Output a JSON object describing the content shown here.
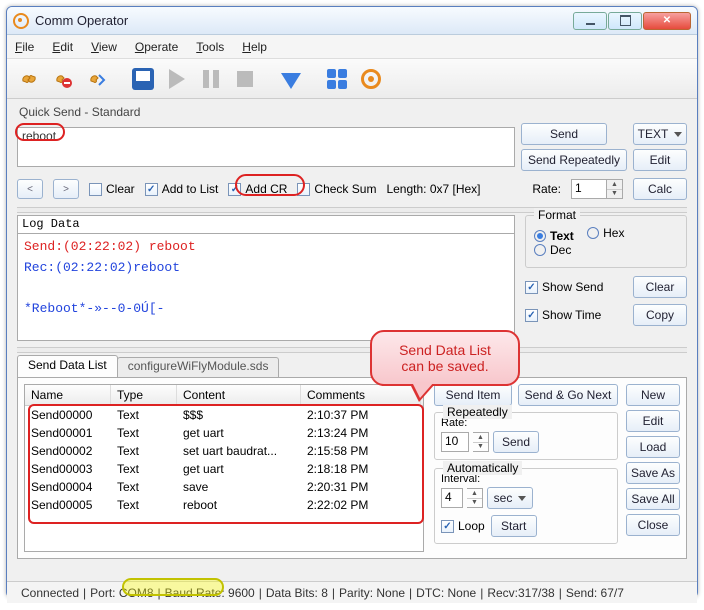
{
  "window": {
    "title": "Comm Operator"
  },
  "menu": {
    "file": "File",
    "edit": "Edit",
    "view": "View",
    "operate": "Operate",
    "tools": "Tools",
    "help": "Help"
  },
  "quicksend": {
    "section_label": "Quick Send - Standard",
    "input_value": "reboot",
    "send": "Send",
    "text_btn": "TEXT",
    "send_repeat": "Send Repeatedly",
    "edit": "Edit",
    "nav_prev": "<",
    "nav_next": ">",
    "clear": "Clear",
    "add_to_list": "Add to List",
    "add_cr": "Add CR",
    "check_sum": "Check Sum",
    "length_label": "Length: 0x7 [Hex]",
    "rate_label": "Rate:",
    "rate_value": "1",
    "calc": "Calc"
  },
  "log": {
    "header": "Log Data",
    "line1": "Send:(02:22:02) reboot",
    "line2": "Rec:(02:22:02)reboot",
    "line3": "*Reboot*-»--0-0Ú[-"
  },
  "format": {
    "legend": "Format",
    "text": "Text",
    "hex": "Hex",
    "dec": "Dec",
    "show_send": "Show Send",
    "show_time": "Show Time",
    "clear": "Clear",
    "copy": "Copy"
  },
  "sendlist": {
    "tab1": "Send Data List",
    "tab2": "configureWiFlyModule.sds",
    "cols": {
      "name": "Name",
      "type": "Type",
      "content": "Content",
      "comments": "Comments"
    },
    "rows": [
      {
        "name": "Send00000",
        "type": "Text",
        "content": "$$$",
        "comments": "2:10:37 PM"
      },
      {
        "name": "Send00001",
        "type": "Text",
        "content": "get uart",
        "comments": "2:13:24 PM"
      },
      {
        "name": "Send00002",
        "type": "Text",
        "content": "set uart baudrat...",
        "comments": "2:15:58 PM"
      },
      {
        "name": "Send00003",
        "type": "Text",
        "content": "get uart",
        "comments": "2:18:18 PM"
      },
      {
        "name": "Send00004",
        "type": "Text",
        "content": "save",
        "comments": "2:20:31 PM"
      },
      {
        "name": "Send00005",
        "type": "Text",
        "content": "reboot",
        "comments": "2:22:02 PM"
      }
    ],
    "send_item": "Send Item",
    "send_go_next": "Send & Go Next",
    "repeatedly": "Repeatedly",
    "rate_label": "Rate:",
    "rate_value": "10",
    "send": "Send",
    "automatically": "Automatically",
    "interval_label": "Interval:",
    "interval_value": "4",
    "interval_unit": "sec",
    "loop": "Loop",
    "start": "Start",
    "new": "New",
    "edit": "Edit",
    "load": "Load",
    "save_as": "Save As",
    "save_all": "Save All",
    "close": "Close"
  },
  "status": {
    "connected": "Connected",
    "port": "Port: COM8",
    "baud": "Baud Rate: 9600",
    "data_bits": "Data Bits: 8",
    "parity": "Parity: None",
    "dtc": "DTC: None",
    "recv": "Recv:317/38",
    "send": "Send: 67/7"
  },
  "annotation": {
    "callout": "Send Data List can be saved."
  }
}
